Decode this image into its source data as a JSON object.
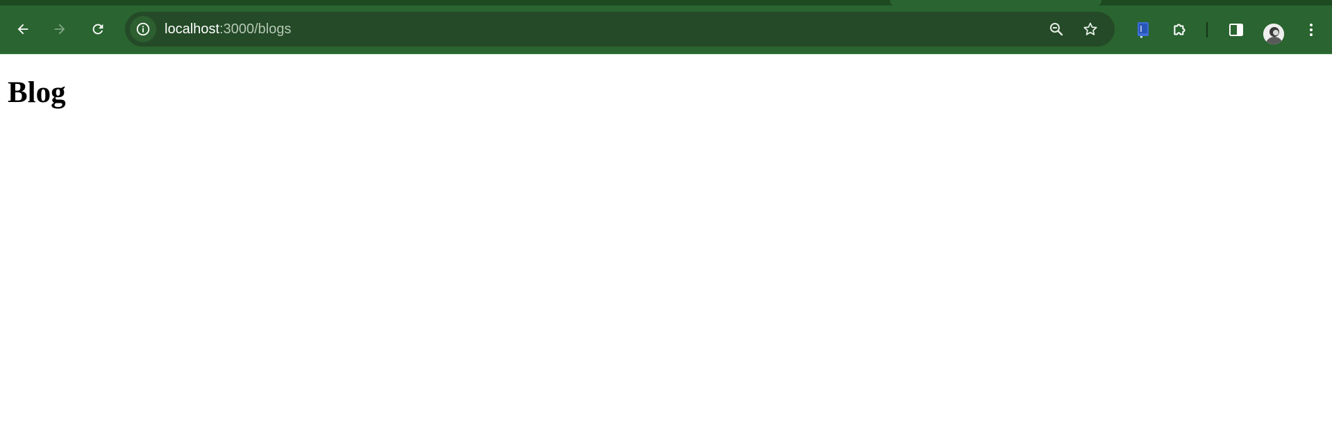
{
  "browser": {
    "colors": {
      "toolbar": "#2a6430",
      "tabstrip": "#1e4a22",
      "omnibox": "#244a27",
      "icon": "#ffffff",
      "icon_disabled": "#7fa483"
    },
    "toolbar": {
      "back_icon": "arrow-left-icon",
      "forward_icon": "arrow-right-icon",
      "reload_icon": "reload-icon",
      "site_info_icon": "info-icon",
      "zoom_icon": "zoom-out-icon",
      "bookmark_icon": "star-outline-icon",
      "extension_icon": "book-extension-icon",
      "extensions_menu_icon": "puzzle-icon",
      "side_panel_icon": "side-panel-icon",
      "profile_icon": "avatar",
      "menu_icon": "kebab-menu-icon"
    },
    "address_bar": {
      "host": "localhost",
      "path": ":3000/blogs"
    }
  },
  "page": {
    "title": "Blog"
  }
}
